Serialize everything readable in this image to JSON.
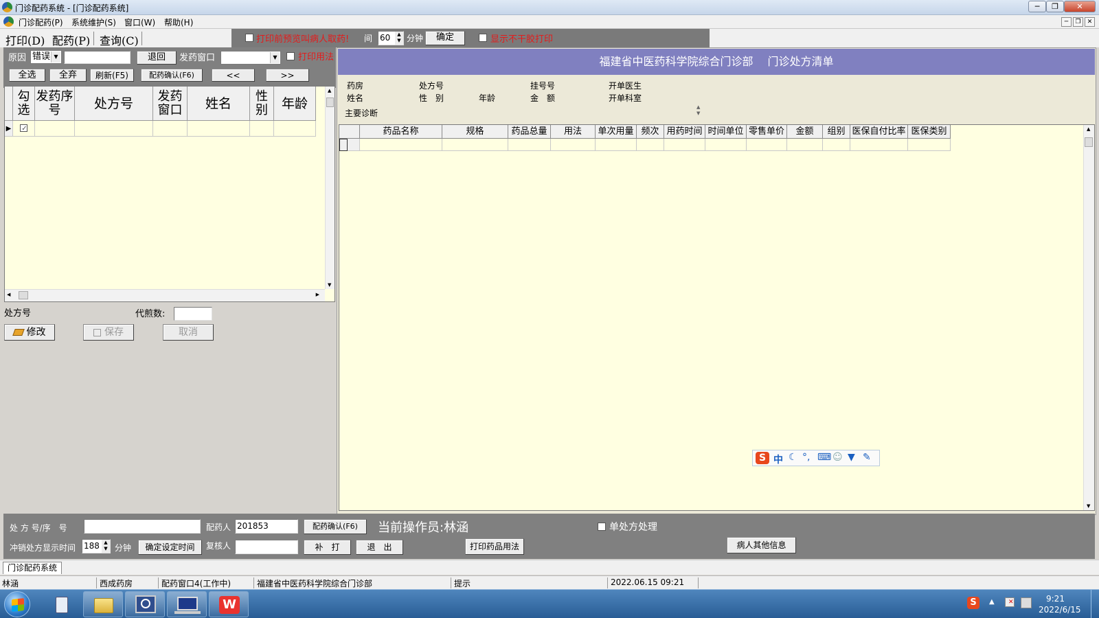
{
  "window": {
    "title": "门诊配药系统 - [门诊配药系统]"
  },
  "menu": [
    "门诊配药(P)",
    "系统维护(S)",
    "窗口(W)",
    "帮助(H)"
  ],
  "tabs": [
    "打印(D)",
    "配药(P)",
    "查询(C)"
  ],
  "top_options": {
    "preview_label": "打印前预览叫病人取药!",
    "interval_label": "间",
    "interval_value": "60",
    "minutes_label": "分钟",
    "confirm_label": "确定",
    "show_noprint_label": "显示不干胶打印"
  },
  "left_controls": {
    "reason_label": "原因",
    "reason_value": "错误",
    "return_label": "退回",
    "window_label": "发药窗口",
    "print_usage_label": "打印用法",
    "select_all_label": "全选",
    "discard_all_label": "全弃",
    "refresh_label": "刷新(F5)",
    "confirm_dispense_label": "配药确认(F6)",
    "prev_label": "<<",
    "next_label": ">>"
  },
  "left_grid": {
    "headers": [
      "勾选",
      "发药序号",
      "处方号",
      "发药窗口",
      "姓名",
      "性别",
      "年龄"
    ],
    "checked": true
  },
  "left_form": {
    "rx_label": "处方号",
    "decoct_label": "代煎数:",
    "modify_label": "修改",
    "save_label": "保存",
    "cancel_label": "取消"
  },
  "right_panel": {
    "title": "福建省中医药科学院综合门诊部　 门诊处方清单",
    "info": {
      "pharmacy": "药房",
      "rx_no": "处方号",
      "reg_no": "挂号号",
      "doctor": "开单医生",
      "name": "姓名",
      "gender": "性　别",
      "age": "年龄",
      "amount": "金　额",
      "dept": "开单科室",
      "diagnosis": "主要诊断"
    },
    "headers": [
      "药品名称",
      "规格",
      "药品总量",
      "用法",
      "单次用量",
      "频次",
      "用药时间",
      "时间单位",
      "零售单价",
      "金额",
      "组别",
      "医保自付比率",
      "医保类别"
    ]
  },
  "bottom": {
    "rx_seq_label": "处 方 号/序　号",
    "pharmacist_label": "配药人",
    "pharmacist_value": "201853",
    "confirm_label": "配药确认(F6)",
    "operator_text": "当前操作员:林涵",
    "single_rx_label": "单处方处理",
    "reversal_label": "冲销处方显示时间",
    "reversal_value": "188",
    "minutes_label": "分钟",
    "set_time_label": "确定设定时间",
    "reviewer_label": "复核人",
    "reprint_label": "补　打",
    "exit_label": "退　出",
    "print_usage_label": "打印药品用法",
    "patient_info_label": "病人其他信息"
  },
  "mdi_tab": "门诊配药系统",
  "status": [
    "林涵",
    "西成药房",
    "配药窗口4(工作中)",
    "福建省中医药科学院综合门诊部",
    "提示",
    "2022.06.15 09:21"
  ],
  "taskbar": {
    "time": "9:21",
    "date": "2022/6/15"
  },
  "ime": {
    "mode": "中"
  }
}
